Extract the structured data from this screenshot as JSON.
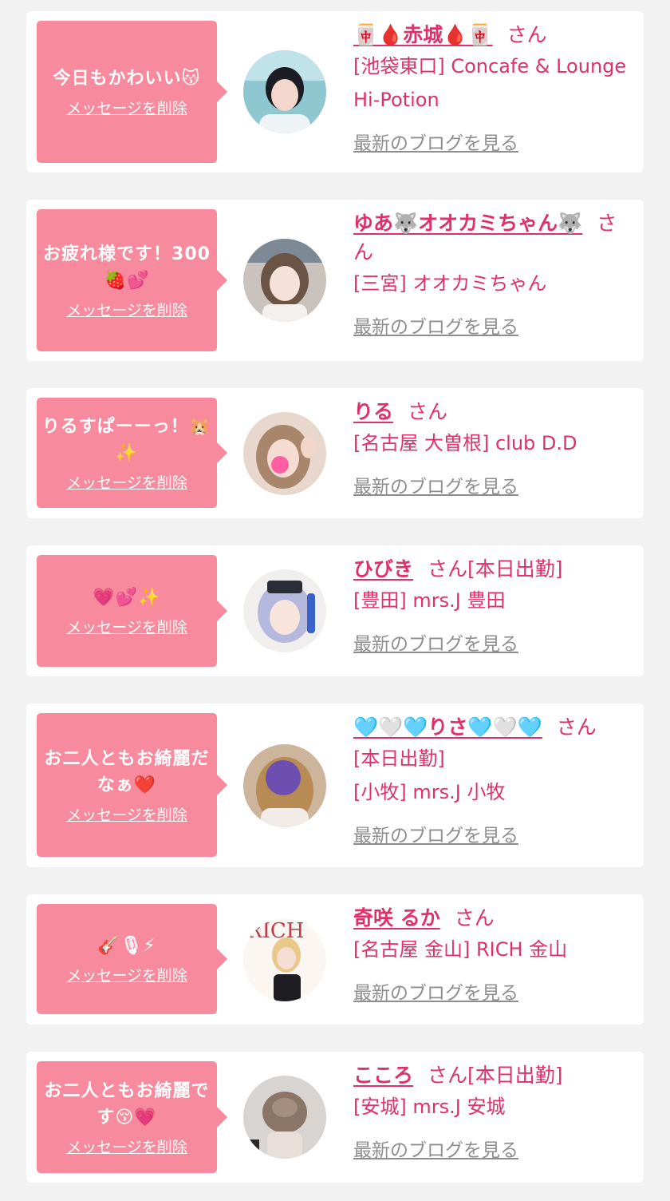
{
  "messages": [
    {
      "message": "今日もかわいい😽",
      "delete_label": "メッセージを削除",
      "name": "🀄🩸赤城🩸🀄",
      "san": "さん",
      "extra": "",
      "shop": "[池袋東口] Concafe & Lounge Hi-Potion",
      "blog_label": "最新のブログを見る"
    },
    {
      "message": "お疲れ様です！300🍓💕",
      "delete_label": "メッセージを削除",
      "name": "ゆあ🐺オオカミちゃん🐺",
      "san": "さん",
      "extra": "",
      "shop": "[三宮] オオカミちゃん",
      "blog_label": "最新のブログを見る"
    },
    {
      "message": "りるすぱーーっ！🐹✨",
      "delete_label": "メッセージを削除",
      "name": "りる",
      "san": "さん",
      "extra": "",
      "shop": "[名古屋 大曽根] club D.D",
      "blog_label": "最新のブログを見る"
    },
    {
      "message": "💗💕✨",
      "delete_label": "メッセージを削除",
      "name": "ひびき",
      "san": "さん",
      "extra": "[本日出勤]",
      "shop": "[豊田] mrs.J 豊田",
      "blog_label": "最新のブログを見る"
    },
    {
      "message": "お二人ともお綺麗だなぁ❤️",
      "delete_label": "メッセージを削除",
      "name": "🩵🤍🩵りさ🩵🤍🩵",
      "san": "さん",
      "extra": "[本日出勤]",
      "shop": "[小牧] mrs.J 小牧",
      "blog_label": "最新のブログを見る"
    },
    {
      "message": "🎸🎙⚡",
      "delete_label": "メッセージを削除",
      "name": "奇咲 るか",
      "san": "さん",
      "extra": "",
      "shop": "[名古屋 金山] RICH 金山",
      "blog_label": "最新のブログを見る"
    },
    {
      "message": "お二人ともお綺麗です😚💗",
      "delete_label": "メッセージを削除",
      "name": "こころ",
      "san": "さん",
      "extra": "[本日出勤]",
      "shop": "[安城] mrs.J 安城",
      "blog_label": "最新のブログを見る"
    }
  ]
}
